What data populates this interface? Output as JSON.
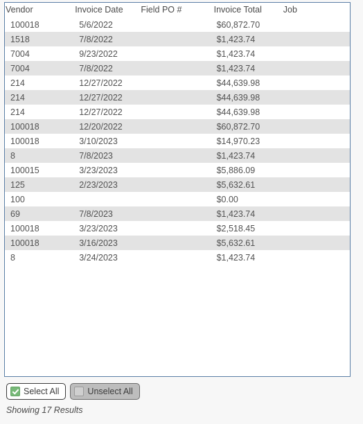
{
  "grid": {
    "columns": [
      "Vendor",
      "Invoice Date",
      "Field PO #",
      "Invoice Total",
      "Job"
    ],
    "rows": [
      {
        "vendor": "100018",
        "invoice_date": "5/6/2022",
        "field_po": "",
        "invoice_total": "$60,872.70",
        "job": ""
      },
      {
        "vendor": "1518",
        "invoice_date": "7/8/2022",
        "field_po": "",
        "invoice_total": "$1,423.74",
        "job": ""
      },
      {
        "vendor": "7004",
        "invoice_date": "9/23/2022",
        "field_po": "",
        "invoice_total": "$1,423.74",
        "job": ""
      },
      {
        "vendor": "7004",
        "invoice_date": "7/8/2022",
        "field_po": "",
        "invoice_total": "$1,423.74",
        "job": ""
      },
      {
        "vendor": "214",
        "invoice_date": "12/27/2022",
        "field_po": "",
        "invoice_total": "$44,639.98",
        "job": ""
      },
      {
        "vendor": "214",
        "invoice_date": "12/27/2022",
        "field_po": "",
        "invoice_total": "$44,639.98",
        "job": ""
      },
      {
        "vendor": "214",
        "invoice_date": "12/27/2022",
        "field_po": "",
        "invoice_total": "$44,639.98",
        "job": ""
      },
      {
        "vendor": "100018",
        "invoice_date": "12/20/2022",
        "field_po": "",
        "invoice_total": "$60,872.70",
        "job": ""
      },
      {
        "vendor": "100018",
        "invoice_date": "3/10/2023",
        "field_po": "",
        "invoice_total": "$14,970.23",
        "job": ""
      },
      {
        "vendor": "8",
        "invoice_date": "7/8/2023",
        "field_po": "",
        "invoice_total": "$1,423.74",
        "job": ""
      },
      {
        "vendor": "100015",
        "invoice_date": "3/23/2023",
        "field_po": "",
        "invoice_total": "$5,886.09",
        "job": ""
      },
      {
        "vendor": "125",
        "invoice_date": "2/23/2023",
        "field_po": "",
        "invoice_total": "$5,632.61",
        "job": ""
      },
      {
        "vendor": "100",
        "invoice_date": "",
        "field_po": "",
        "invoice_total": "$0.00",
        "job": ""
      },
      {
        "vendor": "69",
        "invoice_date": "7/8/2023",
        "field_po": "",
        "invoice_total": "$1,423.74",
        "job": ""
      },
      {
        "vendor": "100018",
        "invoice_date": "3/23/2023",
        "field_po": "",
        "invoice_total": "$2,518.45",
        "job": ""
      },
      {
        "vendor": "100018",
        "invoice_date": "3/16/2023",
        "field_po": "",
        "invoice_total": "$5,632.61",
        "job": ""
      },
      {
        "vendor": "8",
        "invoice_date": "3/24/2023",
        "field_po": "",
        "invoice_total": "$1,423.74",
        "job": ""
      }
    ]
  },
  "toolbar": {
    "select_all_label": "Select All",
    "select_all_icon": "checkbox-checked-icon",
    "unselect_all_label": "Unselect All",
    "unselect_all_icon": "checkbox-unchecked-icon"
  },
  "status": {
    "results_text": "Showing 17 Results"
  },
  "colors": {
    "panel_border": "#5a7ea6",
    "row_alt_background": "#e3e3e3",
    "row_background": "#ffffff",
    "page_background": "#f7f7f7",
    "checkbox_checked": "#77b978",
    "checkbox_unchecked": "#cfcfcf",
    "text": "#4a4a4a"
  }
}
